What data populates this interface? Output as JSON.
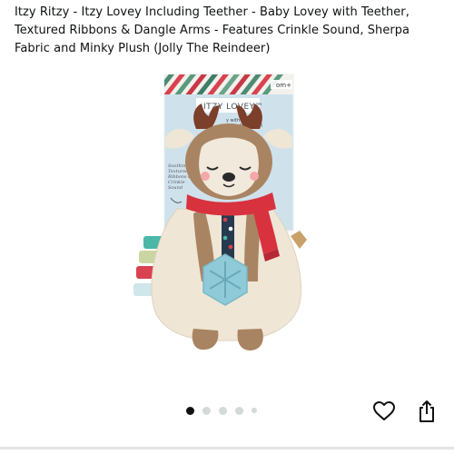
{
  "product": {
    "title": "Itzy Ritzy - Itzy Lovey Including Teether - Baby Lovey with Teether, Textured Ribbons & Dangle Arms - Features Crinkle Sound, Sherpa Fabric and Minky Plush (Jolly The Reindeer)"
  },
  "packaging": {
    "brand_label": "ITZY LOVEY™",
    "tag_text": "om+",
    "features_text": "y with Textured\nAnus Arms • Cri",
    "side_notes": "Soothing\nTextured\nRibbons &\nCrinkle\nSound"
  },
  "carousel": {
    "image_count": 5,
    "active_index": 0
  },
  "actions": {
    "wishlist_icon": "heart-outline-icon",
    "share_icon": "share-icon"
  },
  "colors": {
    "scarf": "#d8323f",
    "fleece": "#efe6d6",
    "fur": "#a98462",
    "teether": "#8fcad8",
    "card": "#cfe2ec"
  }
}
